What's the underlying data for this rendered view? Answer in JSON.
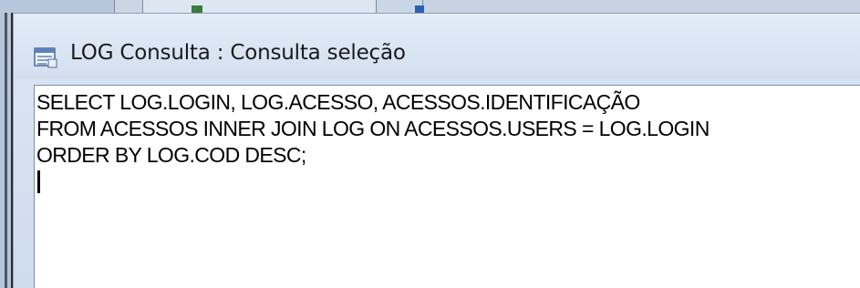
{
  "window": {
    "title": "LOG Consulta : Consulta seleção",
    "icon": "query-datasheet-icon"
  },
  "editor": {
    "lines": [
      "SELECT LOG.LOGIN, LOG.ACESSO, ACESSOS.IDENTIFICAÇÃO",
      "FROM ACESSOS INNER JOIN LOG ON ACESSOS.USERS = LOG.LOGIN",
      "ORDER BY LOG.COD DESC;"
    ]
  },
  "colors": {
    "title_bar": "#dbe6f4",
    "editor_background": "#ffffff",
    "text": "#000000"
  }
}
